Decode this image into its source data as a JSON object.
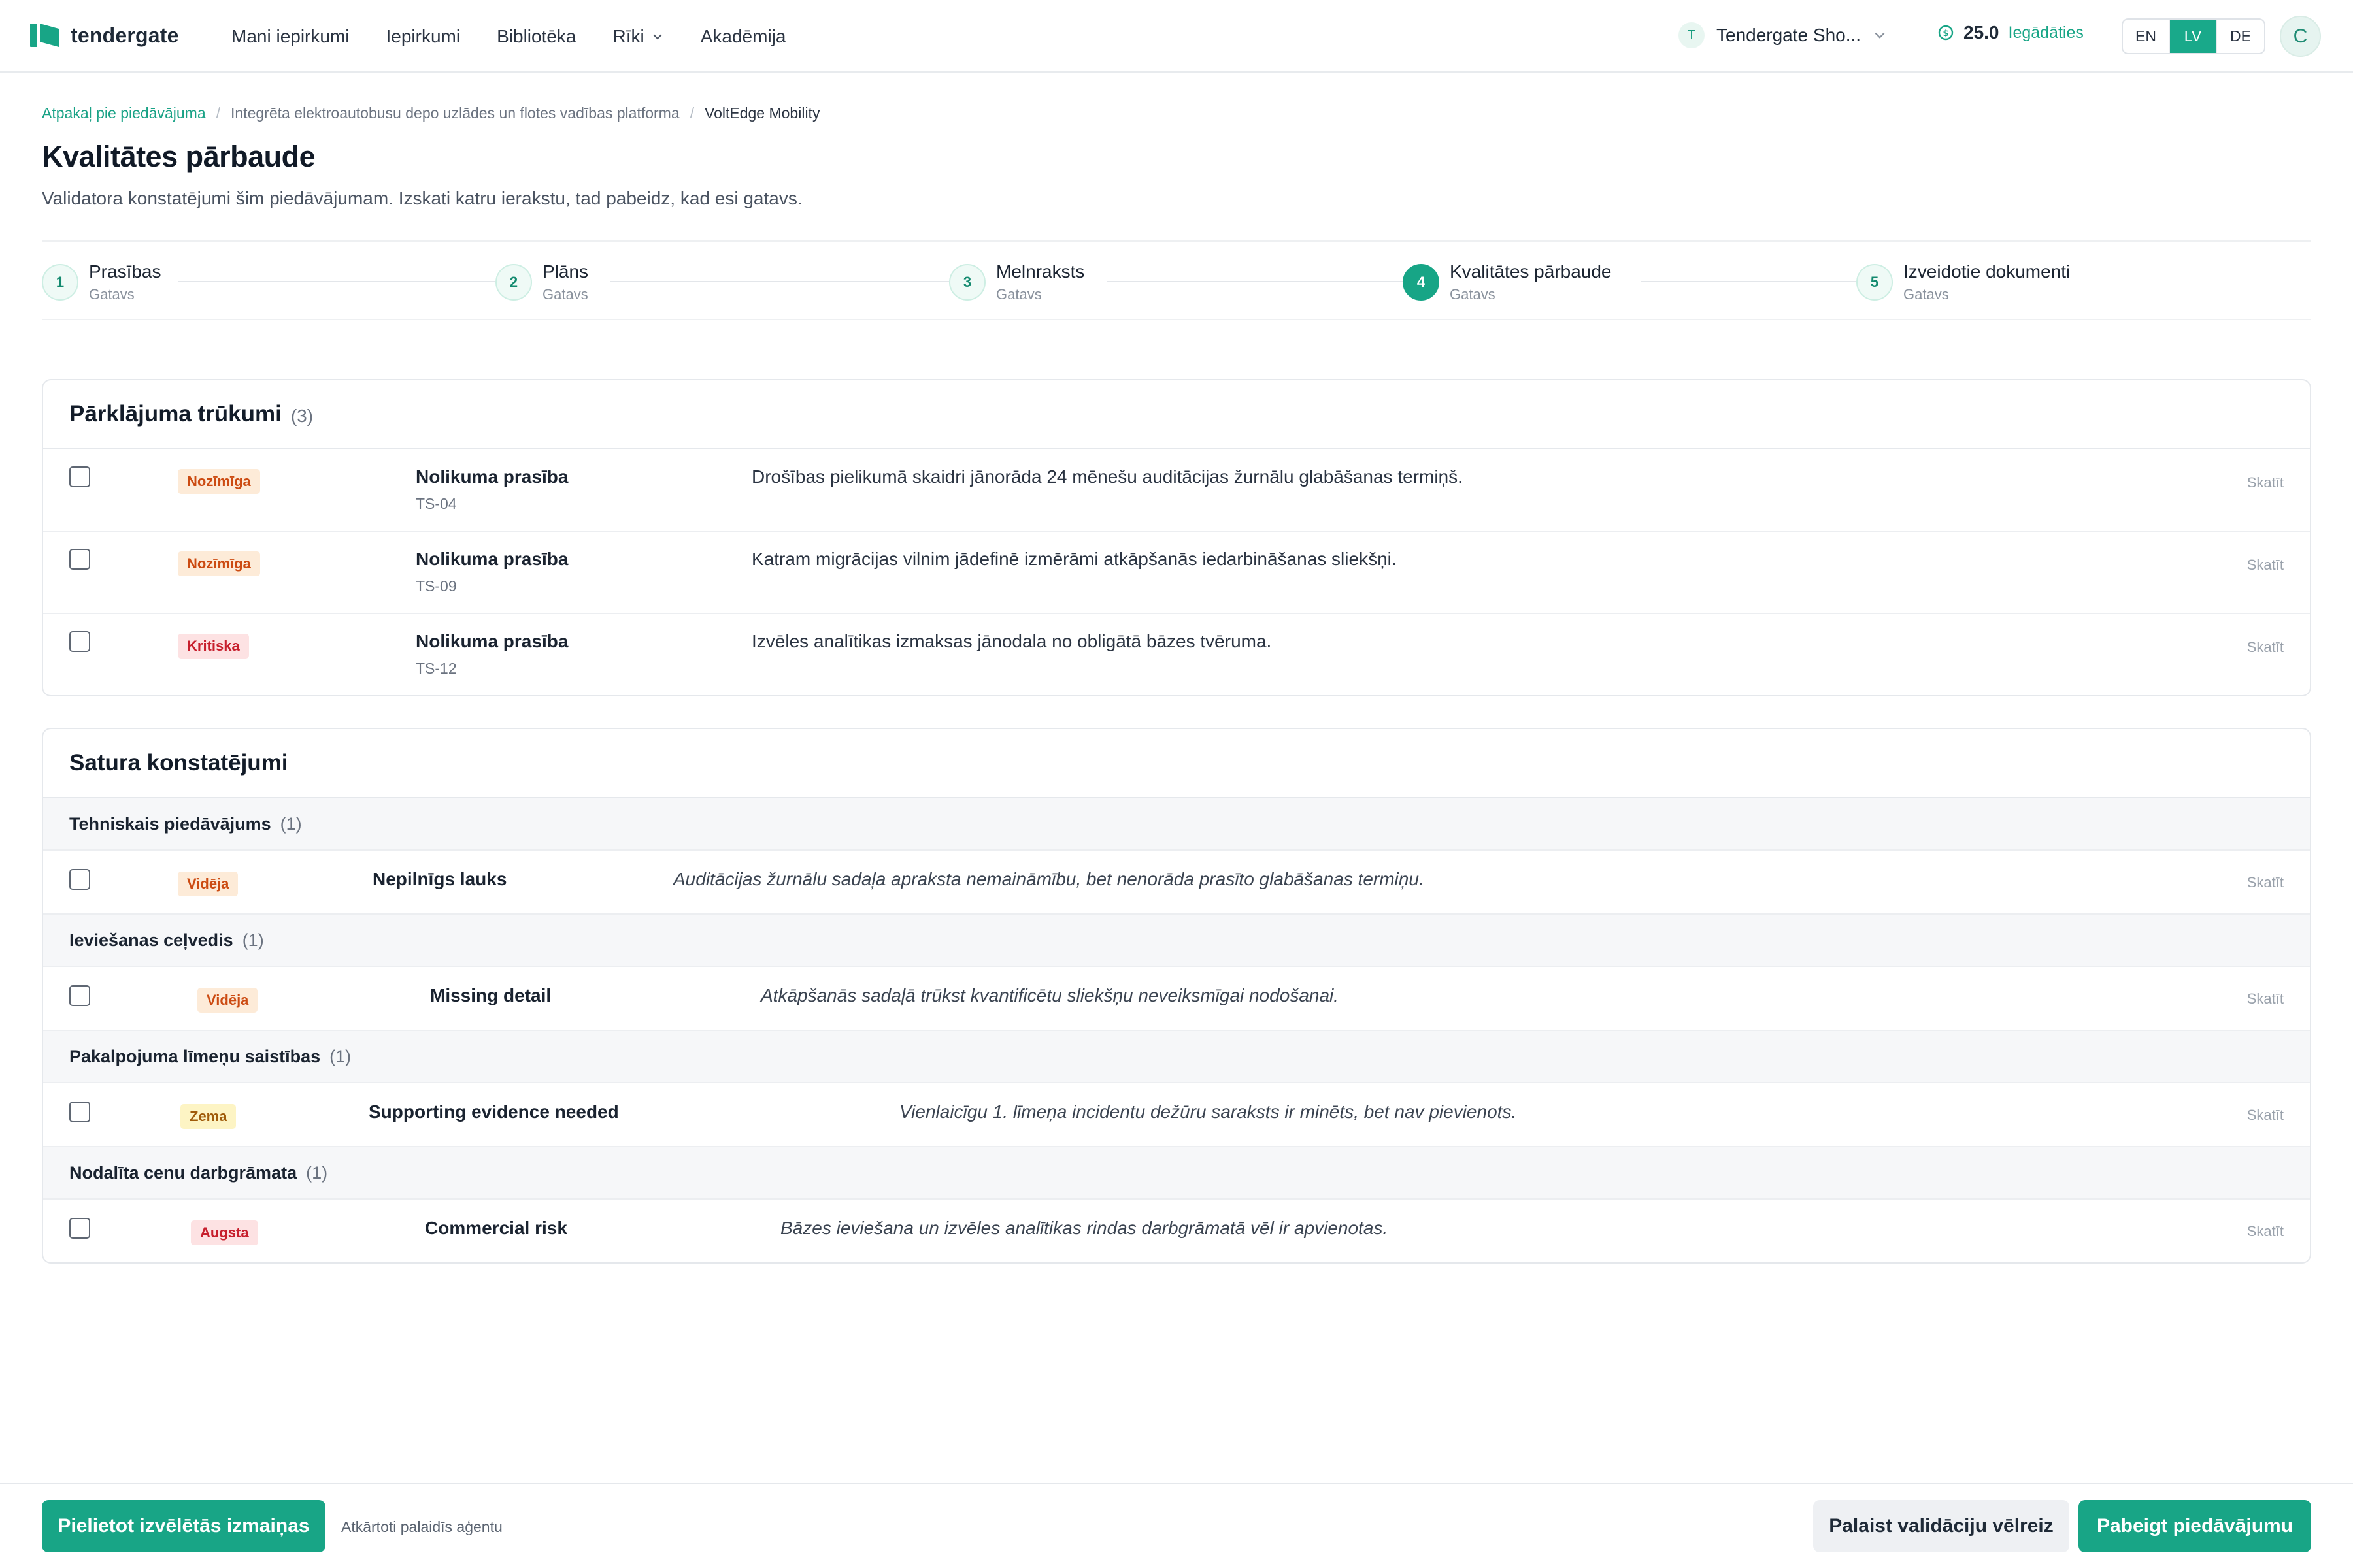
{
  "brand": {
    "name": "tendergate",
    "color": "#18a586"
  },
  "nav": [
    "Mani iepirkumi",
    "Iepirkumi",
    "Bibliotēka",
    "Rīki",
    "Akadēmija"
  ],
  "org": {
    "avatar": "T",
    "name": "Tendergate Sho..."
  },
  "credits": {
    "amount": "25.0",
    "topup": "Iegādāties"
  },
  "languages": [
    "EN",
    "LV",
    "DE"
  ],
  "active_language": "LV",
  "user": {
    "initial": "C"
  },
  "breadcrumb": {
    "back": "Atpakaļ pie piedāvājuma",
    "project": "Integrēta elektroautobusu depo uzlādes un flotes vadības platforma",
    "current": "VoltEdge Mobility"
  },
  "page": {
    "title": "Kvalitātes pārbaude",
    "subtitle": "Validatora konstatējumi šim piedāvājumam. Izskati katru ierakstu, tad pabeidz, kad esi gatavs."
  },
  "steps": [
    {
      "num": "1",
      "title": "Prasības",
      "status": "Gatavs"
    },
    {
      "num": "2",
      "title": "Plāns",
      "status": "Gatavs"
    },
    {
      "num": "3",
      "title": "Melnraksts",
      "status": "Gatavs"
    },
    {
      "num": "4",
      "title": "Kvalitātes pārbaude",
      "status": "Gatavs"
    },
    {
      "num": "5",
      "title": "Izveidotie dokumenti",
      "status": "Gatavs"
    }
  ],
  "active_step": 4,
  "coverage": {
    "title": "Pārklājuma trūkumi",
    "count": "(3)",
    "rows": [
      {
        "badge": "Nozīmīga",
        "title": "Nolikuma prasība",
        "code": "TS-04",
        "desc": "Drošības pielikumā skaidri jānorāda 24 mēnešu auditācijas žurnālu glabāšanas termiņš.",
        "view": "Skatīt"
      },
      {
        "badge": "Nozīmīga",
        "title": "Nolikuma prasība",
        "code": "TS-09",
        "desc": "Katram migrācijas vilnim jādefinē izmērāmi atkāpšanās iedarbināšanas sliekšņi.",
        "view": "Skatīt"
      },
      {
        "badge": "Kritiska",
        "title": "Nolikuma prasība",
        "code": "TS-12",
        "desc": "Izvēles analītikas izmaksas jānodala no obligātā bāzes tvēruma.",
        "view": "Skatīt"
      }
    ]
  },
  "content": {
    "title": "Satura konstatējumi",
    "groups": [
      {
        "title": "Tehniskais piedāvājums",
        "count": "(1)",
        "finding": {
          "badge": "Vidēja",
          "title": "Nepilnīgs lauks",
          "desc": "Auditācijas žurnālu sadaļa apraksta nemaināmību, bet nenorāda prasīto glabāšanas termiņu.",
          "view": "Skatīt"
        }
      },
      {
        "title": "Ieviešanas ceļvedis",
        "count": "(1)",
        "finding": {
          "badge": "Vidēja",
          "title": "Missing detail",
          "desc": "Atkāpšanās sadaļā trūkst kvantificētu sliekšņu neveiksmīgai nodošanai.",
          "view": "Skatīt"
        }
      },
      {
        "title": "Pakalpojuma līmeņu saistības",
        "count": "(1)",
        "finding": {
          "badge": "Zema",
          "title": "Supporting evidence needed",
          "desc": "Vienlaicīgu 1. līmeņa incidentu dežūru saraksts ir minēts, bet nav pievienots.",
          "view": "Skatīt"
        }
      },
      {
        "title": "Nodalīta cenu darbgrāmata",
        "count": "(1)",
        "finding": {
          "badge": "Augsta",
          "title": "Commercial risk",
          "desc": "Bāzes ieviešana un izvēles analītikas rindas darbgrāmatā vēl ir apvienotas.",
          "view": "Skatīt"
        }
      }
    ]
  },
  "footer": {
    "apply": "Pielietot izvēlētās izmaiņas",
    "note": "Atkārtoti palaidīs aģentu",
    "rerun": "Palaist validāciju vēlreiz",
    "finish": "Pabeigt piedāvājumu"
  },
  "icons": [
    "logo-icon",
    "chevron-down-icon",
    "coin-icon"
  ]
}
